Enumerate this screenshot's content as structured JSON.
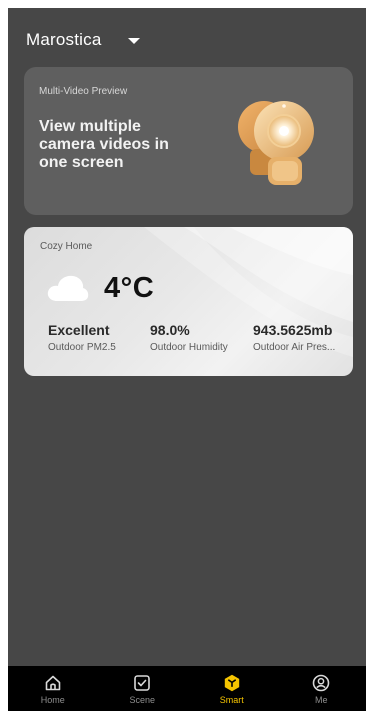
{
  "header": {
    "location": "Marostica",
    "dropdown_icon": "caret-down-icon"
  },
  "promo": {
    "kicker": "Multi-Video Preview",
    "headline": "View multiple camera videos in one screen",
    "icon": "security-camera-icon"
  },
  "weather": {
    "place": "Cozy Home",
    "condition_icon": "cloud-icon",
    "temperature": "4°C",
    "stats": [
      {
        "value": "Excellent",
        "label": "Outdoor PM2.5"
      },
      {
        "value": "98.0%",
        "label": "Outdoor Humidity"
      },
      {
        "value": "943.5625mb",
        "label": "Outdoor Air Pres..."
      }
    ]
  },
  "tabbar": {
    "active_color": "#f5c400",
    "tabs": [
      {
        "label": "Home",
        "icon": "home-icon"
      },
      {
        "label": "Scene",
        "icon": "checkbox-icon"
      },
      {
        "label": "Smart",
        "icon": "smart-hexagon-icon",
        "active": true
      },
      {
        "label": "Me",
        "icon": "profile-icon"
      }
    ]
  }
}
